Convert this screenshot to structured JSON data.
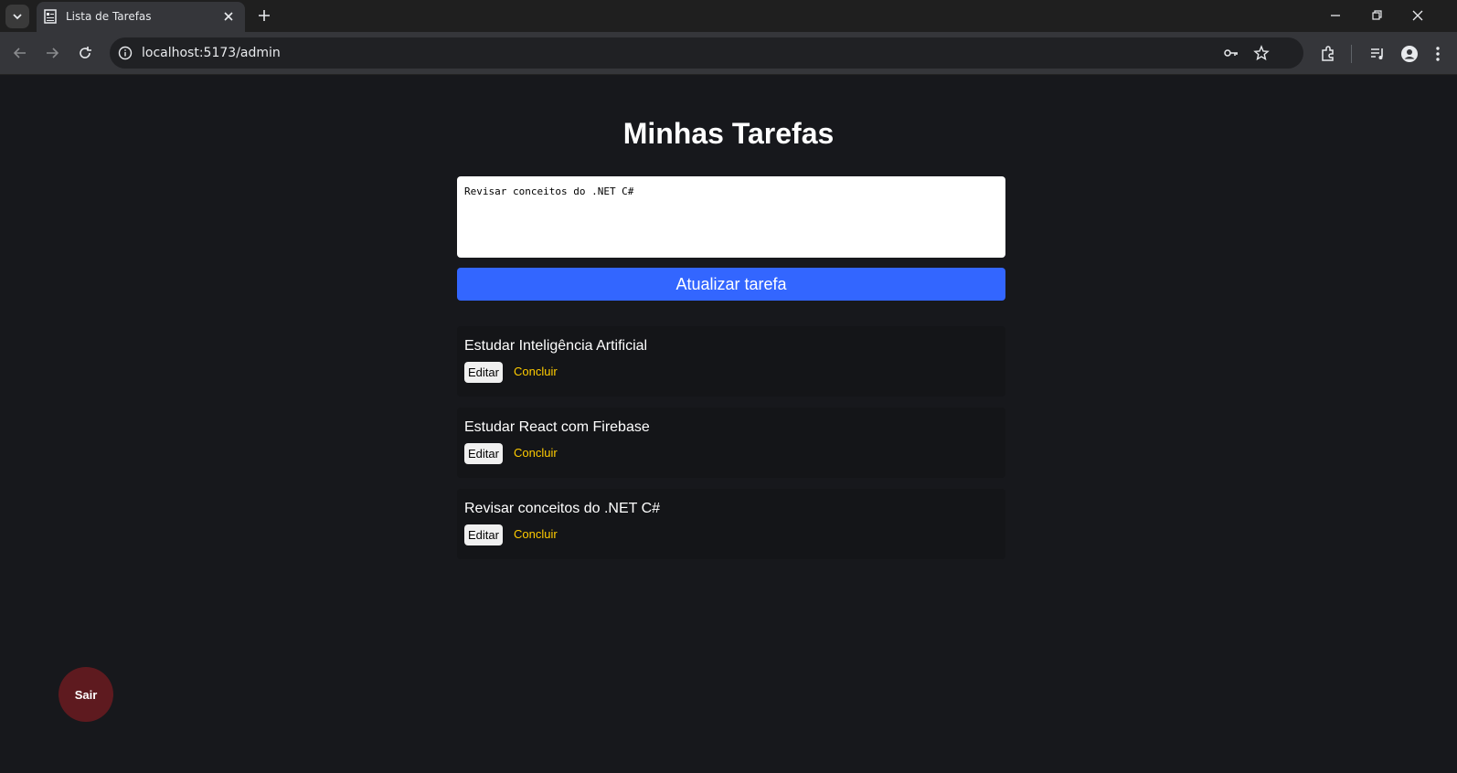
{
  "browser": {
    "tab_title": "Lista de Tarefas",
    "url": "localhost:5173/admin",
    "icons": [
      "tab-list-icon",
      "page-favicon-icon",
      "close-icon",
      "plus-icon",
      "minimize-icon",
      "restore-icon",
      "close-window-icon",
      "back-icon",
      "forward-icon",
      "reload-icon",
      "info-icon",
      "key-icon",
      "star-icon",
      "extensions-icon",
      "media-icon",
      "profile-icon",
      "menu-icon"
    ]
  },
  "page": {
    "title": "Minhas Tarefas",
    "input_value": "Revisar conceitos do .NET C#",
    "submit_label": "Atualizar tarefa",
    "tasks": [
      {
        "text": "Estudar Inteligência Artificial",
        "edit": "Editar",
        "done": "Concluir"
      },
      {
        "text": "Estudar React com Firebase",
        "edit": "Editar",
        "done": "Concluir"
      },
      {
        "text": "Revisar conceitos do .NET C#",
        "edit": "Editar",
        "done": "Concluir"
      }
    ],
    "logout_label": "Sair"
  },
  "colors": {
    "background": "#17181c",
    "primary_button": "#3366ff",
    "accent_link": "#ffcc00",
    "logout_button": "#5e1a1f",
    "task_card": "#141518"
  }
}
